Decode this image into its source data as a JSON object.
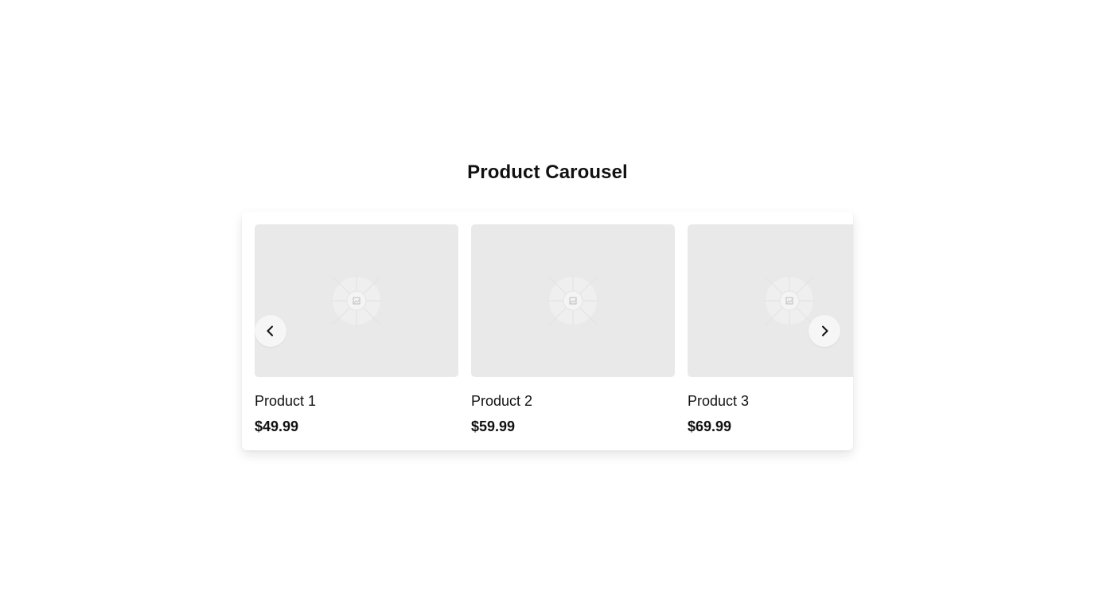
{
  "page": {
    "title": "Product Carousel"
  },
  "carousel": {
    "prev_icon": "chevron-left-icon",
    "next_icon": "chevron-right-icon",
    "placeholder_icon": "image-placeholder-icon",
    "products": [
      {
        "name": "Product 1",
        "price": "$49.99"
      },
      {
        "name": "Product 2",
        "price": "$59.99"
      },
      {
        "name": "Product 3",
        "price": "$69.99"
      }
    ]
  },
  "colors": {
    "background": "#ffffff",
    "text": "#111111",
    "thumbnail": "#e9e9e9",
    "nav_button": "#f6f6f6"
  }
}
